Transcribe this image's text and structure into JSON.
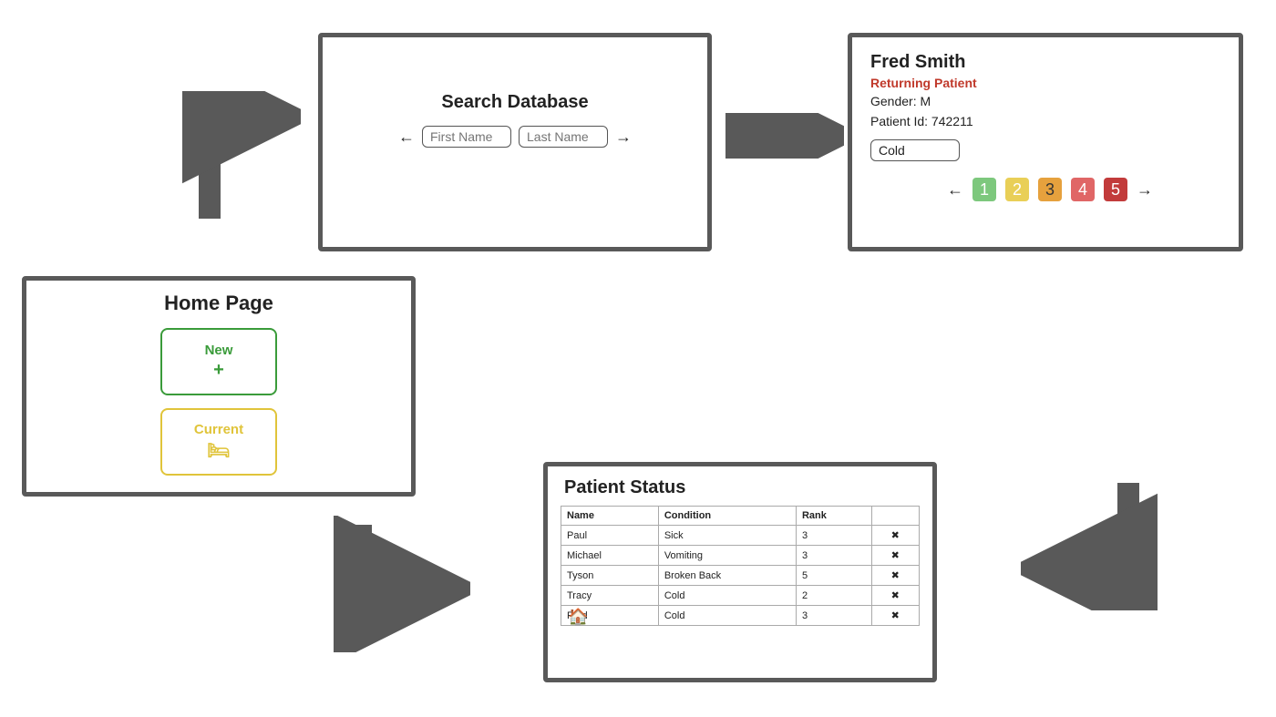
{
  "home": {
    "title": "Home Page",
    "new_label": "New",
    "current_label": "Current"
  },
  "search": {
    "title": "Search Database",
    "first_name_placeholder": "First Name",
    "last_name_placeholder": "Last Name"
  },
  "patient": {
    "name": "Fred Smith",
    "status_label": "Returning Patient",
    "status_color": "#c0392b",
    "gender_label": "Gender: M",
    "id_label": "Patient Id: 742211",
    "condition": "Cold",
    "ranks": [
      "1",
      "2",
      "3",
      "4",
      "5"
    ]
  },
  "status_panel": {
    "title": "Patient Status",
    "headers": [
      "Name",
      "Condition",
      "Rank",
      ""
    ],
    "rows": [
      {
        "name": "Paul",
        "condition": "Sick",
        "rank": "3"
      },
      {
        "name": "Michael",
        "condition": "Vomiting",
        "rank": "3"
      },
      {
        "name": "Tyson",
        "condition": "Broken Back",
        "rank": "5"
      },
      {
        "name": "Tracy",
        "condition": "Cold",
        "rank": "2"
      },
      {
        "name": "Fred",
        "condition": "Cold",
        "rank": "3"
      }
    ]
  },
  "icons": {
    "plus": "+",
    "bed": "🛏",
    "left": "←",
    "right": "→",
    "delete": "✖",
    "home": "🏠"
  }
}
